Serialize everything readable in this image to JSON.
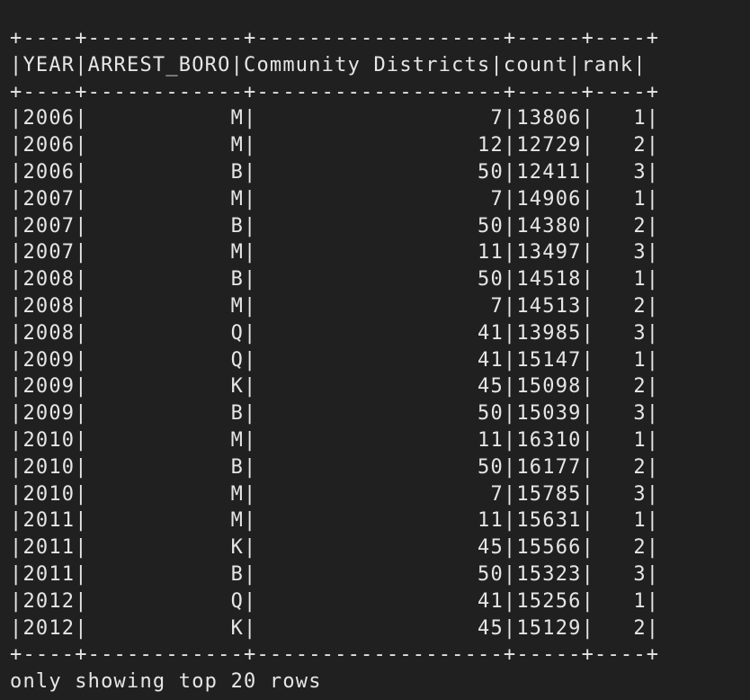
{
  "terminal": {
    "border": "+----+------------+-------------------+-----+----+",
    "header": "|YEAR|ARREST_BORO|Community Districts|count|rank|",
    "rows": [
      "|2006|           M|                  7|13806|   1|",
      "|2006|           M|                 12|12729|   2|",
      "|2006|           B|                 50|12411|   3|",
      "|2007|           M|                  7|14906|   1|",
      "|2007|           B|                 50|14380|   2|",
      "|2007|           M|                 11|13497|   3|",
      "|2008|           B|                 50|14518|   1|",
      "|2008|           M|                  7|14513|   2|",
      "|2008|           Q|                 41|13985|   3|",
      "|2009|           Q|                 41|15147|   1|",
      "|2009|           K|                 45|15098|   2|",
      "|2009|           B|                 50|15039|   3|",
      "|2010|           M|                 11|16310|   1|",
      "|2010|           B|                 50|16177|   2|",
      "|2010|           M|                  7|15785|   3|",
      "|2011|           M|                 11|15631|   1|",
      "|2011|           K|                 45|15566|   2|",
      "|2011|           B|                 50|15323|   3|",
      "|2012|           Q|                 41|15256|   1|",
      "|2012|           K|                 45|15129|   2|"
    ],
    "footer_note": "only showing top 20 rows"
  }
}
